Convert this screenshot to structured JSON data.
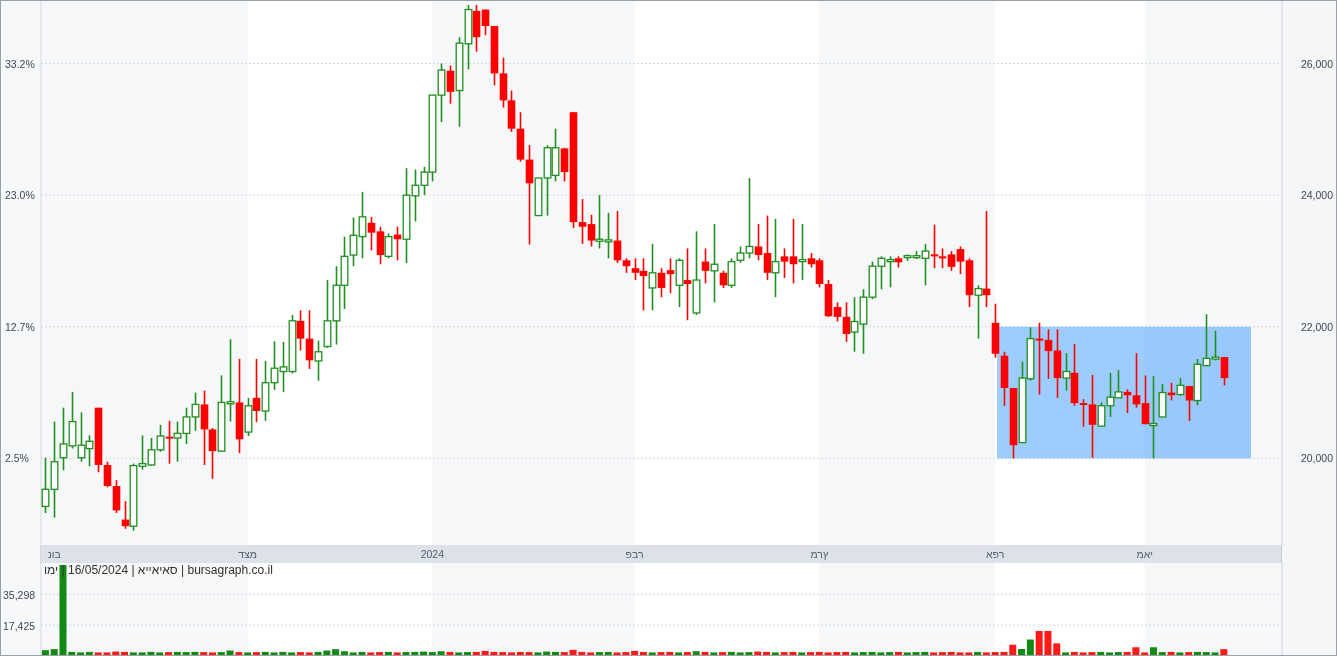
{
  "price_chart": {
    "percent_labels": [
      "33.2%",
      "23.0%",
      "12.7%",
      "2.5%"
    ],
    "chart_data": {
      "type": "candlestick",
      "ylim": [
        18684,
        26950
      ],
      "grid": true,
      "categories": [
        null,
        "נוב",
        null,
        null,
        null,
        null,
        null,
        null,
        null,
        null,
        null,
        null,
        null,
        null,
        null,
        null,
        null,
        null,
        null,
        null,
        null,
        null,
        null,
        "דצמ",
        null,
        null,
        null,
        null,
        null,
        null,
        null,
        null,
        null,
        null,
        null,
        null,
        null,
        null,
        null,
        null,
        null,
        null,
        null,
        null,
        "2024",
        null,
        null,
        null,
        null,
        null,
        null,
        null,
        null,
        null,
        null,
        null,
        null,
        null,
        null,
        null,
        null,
        null,
        null,
        null,
        null,
        null,
        null,
        "פבר",
        null,
        null,
        null,
        null,
        null,
        null,
        null,
        null,
        null,
        null,
        null,
        null,
        null,
        null,
        null,
        null,
        null,
        null,
        null,
        null,
        "מרץ",
        null,
        null,
        null,
        null,
        null,
        null,
        null,
        null,
        null,
        null,
        null,
        null,
        null,
        null,
        null,
        null,
        null,
        null,
        null,
        "אפר",
        null,
        null,
        null,
        null,
        null,
        null,
        null,
        null,
        null,
        null,
        null,
        null,
        null,
        null,
        null,
        null,
        "מאי",
        null,
        null,
        null,
        null,
        null,
        null,
        null,
        null,
        null,
        null,
        null,
        null,
        null,
        null,
        null
      ],
      "yticks": [
        {
          "value": 26000,
          "label": "26,000"
        },
        {
          "value": 24000,
          "label": "24,000"
        },
        {
          "value": 22000,
          "label": "22,000"
        },
        {
          "value": 20000,
          "label": "20,000"
        }
      ],
      "ohlc": [
        [
          19270,
          20010,
          19170,
          19530
        ],
        [
          19530,
          20560,
          19100,
          19950
        ],
        [
          20010,
          20770,
          19820,
          20220
        ],
        [
          20190,
          21010,
          20150,
          20560
        ],
        [
          20010,
          20700,
          19950,
          20200
        ],
        [
          20150,
          20350,
          19880,
          20260
        ],
        [
          20770,
          20770,
          19790,
          19900
        ],
        [
          19900,
          19950,
          19560,
          19580
        ],
        [
          19580,
          19670,
          19170,
          19210
        ],
        [
          19070,
          19350,
          18930,
          18970
        ],
        [
          18970,
          19920,
          18900,
          19890
        ],
        [
          19880,
          20350,
          19830,
          19920
        ],
        [
          19900,
          20310,
          19890,
          20130
        ],
        [
          20130,
          20510,
          20100,
          20340
        ],
        [
          20330,
          20570,
          19920,
          20310
        ],
        [
          20310,
          20560,
          19950,
          20380
        ],
        [
          20380,
          20770,
          20220,
          20630
        ],
        [
          20630,
          21000,
          20420,
          20820
        ],
        [
          20820,
          21030,
          19900,
          20440
        ],
        [
          20440,
          20460,
          19690,
          20110
        ],
        [
          20110,
          21260,
          20100,
          20850
        ],
        [
          20850,
          21810,
          20560,
          20860
        ],
        [
          20850,
          21510,
          20080,
          20290
        ],
        [
          20400,
          20920,
          20340,
          20800
        ],
        [
          20920,
          21510,
          20550,
          20720
        ],
        [
          20720,
          21480,
          20570,
          21150
        ],
        [
          21150,
          21780,
          21040,
          21370
        ],
        [
          21320,
          21770,
          21010,
          21390
        ],
        [
          21320,
          22180,
          21290,
          22090
        ],
        [
          22090,
          22250,
          21640,
          21820
        ],
        [
          21820,
          22250,
          21360,
          21490
        ],
        [
          21480,
          21790,
          21180,
          21620
        ],
        [
          21700,
          22710,
          21680,
          22090
        ],
        [
          22090,
          22920,
          21730,
          22630
        ],
        [
          22630,
          23370,
          22270,
          23070
        ],
        [
          23090,
          23660,
          22920,
          23390
        ],
        [
          23370,
          24050,
          23040,
          23670
        ],
        [
          23580,
          23670,
          23160,
          23430
        ],
        [
          23450,
          23520,
          22950,
          23090
        ],
        [
          23070,
          23420,
          23040,
          23370
        ],
        [
          23400,
          23520,
          23010,
          23330
        ],
        [
          23330,
          24410,
          22970,
          24000
        ],
        [
          23990,
          24390,
          23600,
          24150
        ],
        [
          24150,
          24430,
          24000,
          24350
        ],
        [
          24350,
          25520,
          24210,
          25520
        ],
        [
          25520,
          26000,
          25110,
          25900
        ],
        [
          25890,
          25970,
          25390,
          25570
        ],
        [
          25590,
          26400,
          25040,
          26310
        ],
        [
          26300,
          26890,
          25910,
          26820
        ],
        [
          26800,
          26890,
          26180,
          26400
        ],
        [
          26820,
          26820,
          26430,
          26570
        ],
        [
          26570,
          26570,
          25670,
          25850
        ],
        [
          25850,
          26090,
          25330,
          25440
        ],
        [
          25440,
          25590,
          24960,
          25010
        ],
        [
          25010,
          25260,
          24510,
          24540
        ],
        [
          24540,
          24760,
          23250,
          24180
        ],
        [
          23690,
          24260,
          23680,
          24260
        ],
        [
          24260,
          24760,
          23690,
          24720
        ],
        [
          24300,
          25010,
          24210,
          24720
        ],
        [
          24710,
          24720,
          24210,
          24350
        ],
        [
          25260,
          25260,
          23500,
          23590
        ],
        [
          23590,
          23940,
          23260,
          23520
        ],
        [
          23560,
          23700,
          23220,
          23310
        ],
        [
          23310,
          24000,
          23190,
          23330
        ],
        [
          23310,
          23730,
          23040,
          23320
        ],
        [
          23310,
          23760,
          22970,
          23010
        ],
        [
          23010,
          23040,
          22820,
          22920
        ],
        [
          22890,
          23040,
          22710,
          22820
        ],
        [
          22850,
          23040,
          22250,
          22770
        ],
        [
          22590,
          23260,
          22250,
          22820
        ],
        [
          22820,
          22890,
          22450,
          22590
        ],
        [
          22860,
          23040,
          22510,
          22800
        ],
        [
          22630,
          23040,
          22300,
          23010
        ],
        [
          22710,
          23190,
          22100,
          22650
        ],
        [
          22210,
          23450,
          22180,
          22710
        ],
        [
          22990,
          23190,
          22660,
          22850
        ],
        [
          22850,
          23560,
          22370,
          22950
        ],
        [
          22820,
          22850,
          22590,
          22630
        ],
        [
          22630,
          23040,
          22590,
          22990
        ],
        [
          23010,
          23220,
          22970,
          23120
        ],
        [
          23120,
          24260,
          23040,
          23220
        ],
        [
          23220,
          23560,
          23010,
          23090
        ],
        [
          23120,
          23690,
          22710,
          22820
        ],
        [
          22820,
          23640,
          22450,
          22990
        ],
        [
          23070,
          23190,
          22740,
          22990
        ],
        [
          23070,
          23640,
          22660,
          22950
        ],
        [
          23010,
          23560,
          22710,
          23020
        ],
        [
          23040,
          23120,
          22900,
          22950
        ],
        [
          23010,
          23040,
          22600,
          22650
        ],
        [
          22650,
          22710,
          22150,
          22160
        ],
        [
          22300,
          22370,
          22080,
          22150
        ],
        [
          22150,
          22370,
          21770,
          21890
        ],
        [
          21920,
          22450,
          21620,
          22080
        ],
        [
          22040,
          22570,
          21590,
          22450
        ],
        [
          22450,
          22990,
          22420,
          22920
        ],
        [
          22920,
          23070,
          22570,
          23040
        ],
        [
          23010,
          23070,
          22600,
          23020
        ],
        [
          23040,
          23070,
          22900,
          22980
        ],
        [
          23070,
          23100,
          23000,
          23080
        ],
        [
          23070,
          23150,
          23030,
          23080
        ],
        [
          23040,
          23260,
          22630,
          23150
        ],
        [
          23100,
          23550,
          22890,
          23070
        ],
        [
          23070,
          23190,
          22890,
          23050
        ],
        [
          23100,
          23150,
          22850,
          22910
        ],
        [
          23180,
          23220,
          22800,
          22990
        ],
        [
          23010,
          23040,
          22300,
          22480
        ],
        [
          22480,
          22630,
          21820,
          22580
        ],
        [
          22580,
          23760,
          22300,
          22480
        ],
        [
          22060,
          22350,
          21530,
          21590
        ],
        [
          21560,
          21620,
          20800,
          21070
        ],
        [
          21070,
          21070,
          20000,
          20200
        ],
        [
          20240,
          21470,
          20240,
          21220
        ],
        [
          21210,
          21990,
          21180,
          21820
        ],
        [
          21820,
          22060,
          20970,
          21790
        ],
        [
          21800,
          21960,
          21210,
          21630
        ],
        [
          21640,
          21960,
          20920,
          21220
        ],
        [
          21220,
          21600,
          21030,
          21320
        ],
        [
          21300,
          21740,
          20800,
          20840
        ],
        [
          20840,
          20900,
          20480,
          20810
        ],
        [
          20820,
          21270,
          20010,
          20510
        ],
        [
          20490,
          20850,
          20490,
          20800
        ],
        [
          20800,
          21300,
          20630,
          20930
        ],
        [
          20920,
          21340,
          20920,
          21010
        ],
        [
          21010,
          21050,
          20690,
          20960
        ],
        [
          20960,
          21600,
          20770,
          20820
        ],
        [
          20840,
          21260,
          20520,
          20520
        ],
        [
          20520,
          21250,
          20000,
          20530
        ],
        [
          20630,
          21130,
          20630,
          21000
        ],
        [
          21000,
          21150,
          20880,
          20960
        ],
        [
          20970,
          21220,
          20950,
          21110
        ],
        [
          21100,
          21100,
          20570,
          20880
        ],
        [
          20880,
          21510,
          20810,
          21430
        ],
        [
          21410,
          22190,
          21410,
          21520
        ],
        [
          21520,
          21940,
          21490,
          21540
        ],
        [
          21540,
          21540,
          21110,
          21220
        ],
        null,
        null,
        null,
        null,
        null,
        null
      ],
      "bands": [
        {
          "axis": "y",
          "from": 20000,
          "to": 22000
        }
      ]
    }
  },
  "volume_chart": {
    "caption": "ומי | 16/05/2024 | אייאיאס | bursagraph.co.il",
    "chart_data": {
      "type": "bar",
      "ylim": [
        0,
        53000
      ],
      "grid": true,
      "yticks": [
        {
          "value": 35298,
          "label": "35,298"
        },
        {
          "value": 17425,
          "label": "17,425"
        }
      ],
      "values": [
        2800,
        3400,
        52400,
        1800,
        1500,
        1800,
        1500,
        1500,
        2000,
        1800,
        1500,
        1500,
        1800,
        1500,
        1700,
        1800,
        1700,
        1800,
        1700,
        1500,
        1700,
        2600,
        1700,
        1500,
        1700,
        1800,
        1500,
        1800,
        1500,
        1700,
        1500,
        1800,
        2600,
        3400,
        2200,
        1500,
        1800,
        1500,
        1700,
        1800,
        1500,
        1700,
        1800,
        2000,
        1700,
        2200,
        1800,
        1500,
        1700,
        1800,
        2400,
        1800,
        1700,
        1500,
        1800,
        1700,
        1500,
        2000,
        1800,
        1700,
        3000,
        1800,
        1500,
        1700,
        1800,
        1500,
        1700,
        2400,
        1800,
        1500,
        1700,
        1800,
        1500,
        1700,
        2200,
        1800,
        1500,
        1700,
        1800,
        1500,
        1700,
        2000,
        1800,
        1500,
        1700,
        1800,
        1500,
        1700,
        1800,
        1500,
        1700,
        1800,
        1500,
        1700,
        1800,
        1500,
        1700,
        1800,
        1500,
        1700,
        1800,
        1500,
        1700,
        1800,
        1500,
        1500,
        1800,
        1500,
        1700,
        1800,
        6000,
        3500,
        9000,
        14000,
        14000,
        6800,
        1500,
        1800,
        1500,
        1700,
        1800,
        1500,
        1700,
        1800,
        4500,
        1500,
        4500,
        1700,
        1800,
        1500,
        1700,
        1800,
        1700,
        1500,
        3400,
        null,
        null,
        null,
        null,
        null,
        null
      ]
    }
  }
}
